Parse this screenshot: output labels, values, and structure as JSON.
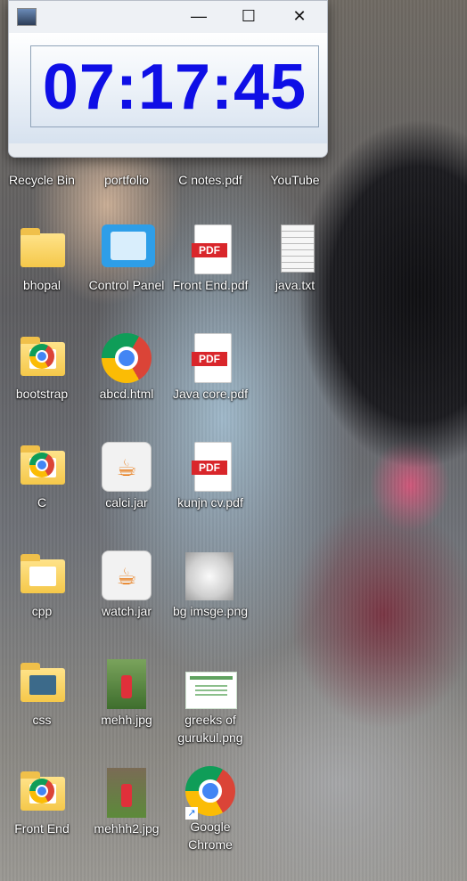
{
  "clock": {
    "time": "07:17:45"
  },
  "window_controls": {
    "minimize": "—",
    "maximize": "☐",
    "close": "✕"
  },
  "desktop": {
    "row1": [
      "Recycle Bin",
      "portfolio",
      "C notes.pdf",
      "YouTube"
    ],
    "col1": [
      "bhopal",
      "bootstrap",
      "C",
      "cpp",
      "css",
      "Front End"
    ],
    "col2": [
      "Control Panel",
      "abcd.html",
      "calci.jar",
      "watch.jar",
      "mehh.jpg",
      "mehhh2.jpg"
    ],
    "col3": [
      "Front End.pdf",
      "Java core.pdf",
      "kunjn cv.pdf",
      "bg imsge.png",
      "greeks of gurukul.png",
      "Google Chrome"
    ],
    "col4": [
      "java.txt"
    ]
  },
  "icons": {
    "pdf_tag": "PDF",
    "java_glyph": "☕",
    "shortcut_glyph": "↗"
  },
  "colors": {
    "clock_text": "#0f0fe6",
    "pdf_red": "#d9262b",
    "folder_yellow": "#f5c84a"
  }
}
